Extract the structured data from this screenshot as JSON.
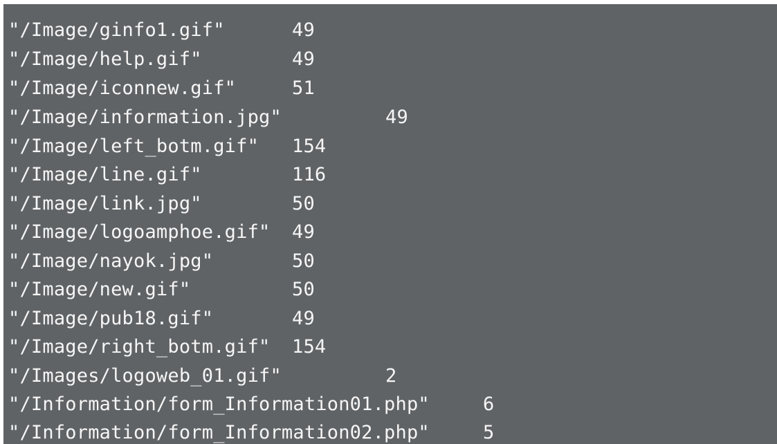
{
  "terminal": {
    "background_color": "#606366",
    "text_color": "#f6f6f6",
    "lines": [
      {
        "path": "\"/Image/ginfo1.gif\"",
        "count": "49"
      },
      {
        "path": "\"/Image/help.gif\"",
        "count": "49"
      },
      {
        "path": "\"/Image/iconnew.gif\"",
        "count": "51"
      },
      {
        "path": "\"/Image/information.jpg\"",
        "count": "49"
      },
      {
        "path": "\"/Image/left_botm.gif\"",
        "count": "154"
      },
      {
        "path": "\"/Image/line.gif\"",
        "count": "116"
      },
      {
        "path": "\"/Image/link.jpg\"",
        "count": "50"
      },
      {
        "path": "\"/Image/logoamphoe.gif\"",
        "count": "49"
      },
      {
        "path": "\"/Image/nayok.jpg\"",
        "count": "50"
      },
      {
        "path": "\"/Image/new.gif\"",
        "count": "50"
      },
      {
        "path": "\"/Image/pub18.gif\"",
        "count": "49"
      },
      {
        "path": "\"/Image/right_botm.gif\"",
        "count": "154"
      },
      {
        "path": "\"/Images/logoweb_01.gif\"",
        "count": "2"
      },
      {
        "path": "\"/Information/form_Information01.php\"",
        "count": "6"
      },
      {
        "path": "\"/Information/form_Information02.php\"",
        "count": "5"
      }
    ]
  }
}
